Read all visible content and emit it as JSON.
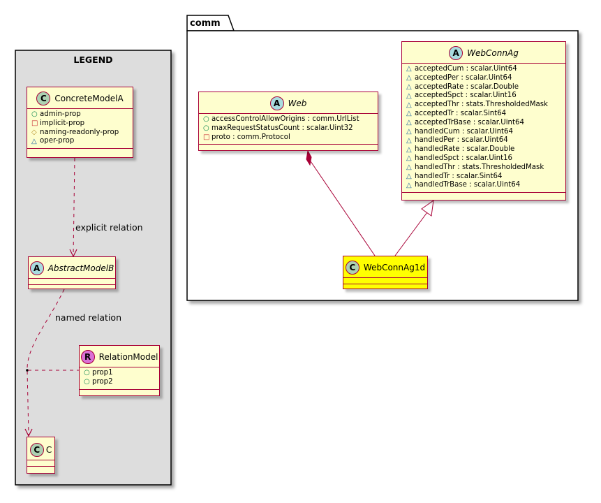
{
  "legend": {
    "title": "LEGEND",
    "relation_explicit": "explicit relation",
    "relation_named": "named relation",
    "concrete": {
      "stereotype": "C",
      "name": "ConcreteModelA",
      "attributes": [
        {
          "vis": "public",
          "text": "admin-prop"
        },
        {
          "vis": "private",
          "text": "implicit-prop"
        },
        {
          "vis": "protected",
          "text": "naming-readonly-prop"
        },
        {
          "vis": "package",
          "text": "oper-prop"
        }
      ]
    },
    "abstract": {
      "stereotype": "A",
      "name": "AbstractModelB"
    },
    "relation_model": {
      "stereotype": "R",
      "name": "RelationModel",
      "attributes": [
        {
          "vis": "public",
          "text": "prop1"
        },
        {
          "vis": "public",
          "text": "prop2"
        }
      ]
    },
    "c_class": {
      "stereotype": "C",
      "name": "C"
    }
  },
  "package": {
    "name": "comm",
    "web": {
      "stereotype": "A",
      "name": "Web",
      "attributes": [
        {
          "vis": "public",
          "text": "accessControlAllowOrigins : comm.UrlList"
        },
        {
          "vis": "public",
          "text": "maxRequestStatusCount : scalar.Uint32"
        },
        {
          "vis": "private",
          "text": "proto : comm.Protocol"
        }
      ]
    },
    "webconnag": {
      "stereotype": "A",
      "name": "WebConnAg",
      "attributes": [
        {
          "vis": "package",
          "text": "acceptedCum : scalar.Uint64"
        },
        {
          "vis": "package",
          "text": "acceptedPer : scalar.Uint64"
        },
        {
          "vis": "package",
          "text": "acceptedRate : scalar.Double"
        },
        {
          "vis": "package",
          "text": "acceptedSpct : scalar.Uint16"
        },
        {
          "vis": "package",
          "text": "acceptedThr : stats.ThresholdedMask"
        },
        {
          "vis": "package",
          "text": "acceptedTr : scalar.Sint64"
        },
        {
          "vis": "package",
          "text": "acceptedTrBase : scalar.Uint64"
        },
        {
          "vis": "package",
          "text": "handledCum : scalar.Uint64"
        },
        {
          "vis": "package",
          "text": "handledPer : scalar.Uint64"
        },
        {
          "vis": "package",
          "text": "handledRate : scalar.Double"
        },
        {
          "vis": "package",
          "text": "handledSpct : scalar.Uint16"
        },
        {
          "vis": "package",
          "text": "handledThr : stats.ThresholdedMask"
        },
        {
          "vis": "package",
          "text": "handledTr : scalar.Sint64"
        },
        {
          "vis": "package",
          "text": "handledTrBase : scalar.Uint64"
        }
      ]
    },
    "webconnag1d": {
      "stereotype": "C",
      "name": "WebConnAg1d"
    }
  },
  "colors": {
    "border": "#A80036",
    "class_fill": "#FEFECE",
    "highlight_fill": "#FFFF00",
    "legend_fill": "#DDDDDD",
    "concrete_circle": "#ADD1B2",
    "abstract_circle": "#A9DCDF",
    "relation_circle": "#DA70D6"
  }
}
